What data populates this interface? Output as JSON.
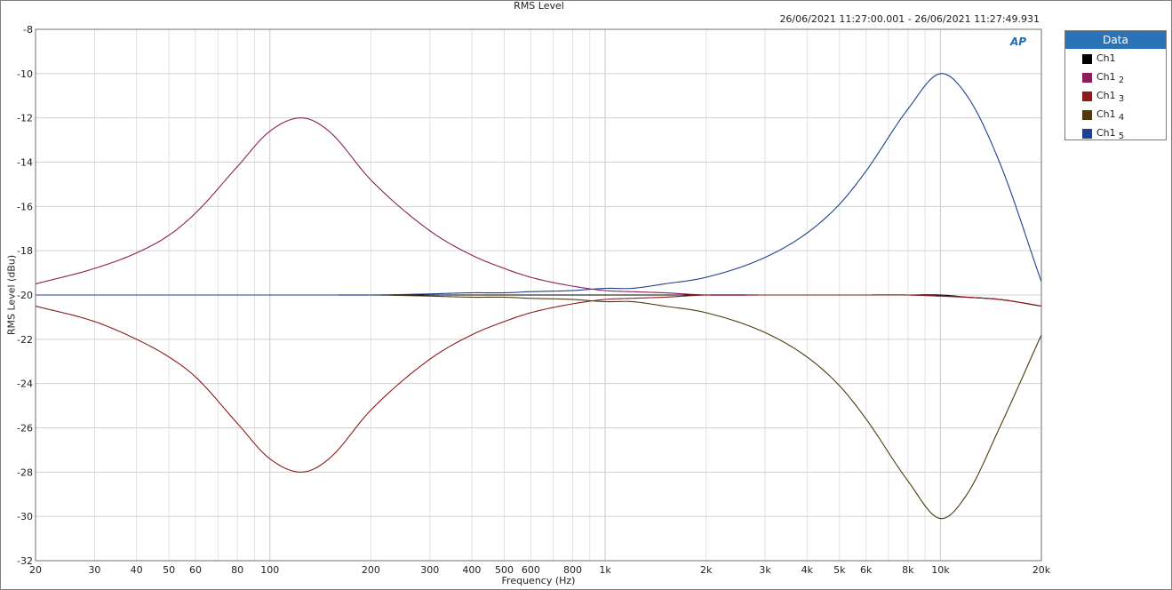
{
  "chart_data": {
    "type": "line",
    "title": "RMS Level",
    "subtitle": "26/06/2021 11:27:00.001 - 26/06/2021 11:27:49.931",
    "xlabel": "Frequency (Hz)",
    "ylabel": "RMS Level (dBu)",
    "xscale": "log",
    "xlim": [
      20,
      20000
    ],
    "ylim": [
      -32,
      -8
    ],
    "grid": true,
    "legend_position": "right",
    "legend_title": "Data",
    "x_ticks": [
      20,
      30,
      40,
      50,
      60,
      80,
      100,
      200,
      300,
      400,
      500,
      600,
      800,
      1000,
      2000,
      3000,
      4000,
      5000,
      6000,
      8000,
      10000,
      20000
    ],
    "x_tick_labels": [
      "20",
      "30",
      "40",
      "50",
      "60",
      "80",
      "100",
      "200",
      "300",
      "400",
      "500",
      "600",
      "800",
      "1k",
      "2k",
      "3k",
      "4k",
      "5k",
      "6k",
      "8k",
      "10k",
      "20k"
    ],
    "y_ticks": [
      -8,
      -10,
      -12,
      -14,
      -16,
      -18,
      -20,
      -22,
      -24,
      -26,
      -28,
      -30,
      -32
    ],
    "y_tick_labels": [
      "-8",
      "-10",
      "-12",
      "-14",
      "-16",
      "-18",
      "-20",
      "-22",
      "-24",
      "-26",
      "-28",
      "-30",
      "-32"
    ],
    "x": [
      20,
      30,
      40,
      50,
      60,
      80,
      100,
      125,
      150,
      200,
      300,
      400,
      500,
      600,
      800,
      1000,
      1200,
      1500,
      2000,
      3000,
      4000,
      5000,
      6000,
      8000,
      10000,
      12000,
      15000,
      20000
    ],
    "series": [
      {
        "name": "Ch1",
        "subscript": "",
        "color": "#000000",
        "values": [
          -20.0,
          -20.0,
          -20.0,
          -20.0,
          -20.0,
          -20.0,
          -20.0,
          -20.0,
          -20.0,
          -20.0,
          -20.0,
          -20.0,
          -20.0,
          -20.0,
          -20.0,
          -20.0,
          -20.0,
          -20.0,
          -20.0,
          -20.0,
          -20.0,
          -20.0,
          -20.0,
          -20.0,
          -20.0,
          -20.1,
          -20.2,
          -20.5
        ]
      },
      {
        "name": "Ch1",
        "subscript": "2",
        "color": "#8b1e5a",
        "values": [
          -19.5,
          -18.8,
          -18.1,
          -17.3,
          -16.3,
          -14.2,
          -12.6,
          -12.0,
          -12.6,
          -14.8,
          -17.1,
          -18.2,
          -18.8,
          -19.2,
          -19.6,
          -19.8,
          -19.85,
          -19.9,
          -20.0,
          -20.0,
          -20.0,
          -20.0,
          -20.0,
          -20.0,
          -20.05,
          -20.1,
          -20.2,
          -20.5
        ]
      },
      {
        "name": "Ch1",
        "subscript": "3",
        "color": "#8b1c1c",
        "values": [
          -20.5,
          -21.2,
          -22.0,
          -22.8,
          -23.7,
          -25.8,
          -27.4,
          -28.0,
          -27.4,
          -25.2,
          -22.9,
          -21.8,
          -21.2,
          -20.8,
          -20.4,
          -20.2,
          -20.15,
          -20.1,
          -20.0,
          -20.0,
          -20.0,
          -20.0,
          -20.0,
          -20.0,
          -20.05,
          -20.1,
          -20.2,
          -20.5
        ]
      },
      {
        "name": "Ch1",
        "subscript": "4",
        "color": "#4d3a10",
        "values": [
          -20.0,
          -20.0,
          -20.0,
          -20.0,
          -20.0,
          -20.0,
          -20.0,
          -20.0,
          -20.0,
          -20.0,
          -20.05,
          -20.1,
          -20.1,
          -20.15,
          -20.2,
          -20.3,
          -20.3,
          -20.5,
          -20.8,
          -21.7,
          -22.8,
          -24.1,
          -25.6,
          -28.4,
          -30.1,
          -29.0,
          -26.0,
          -21.8
        ]
      },
      {
        "name": "Ch1",
        "subscript": "5",
        "color": "#1f3f8f",
        "values": [
          -20.0,
          -20.0,
          -20.0,
          -20.0,
          -20.0,
          -20.0,
          -20.0,
          -20.0,
          -20.0,
          -20.0,
          -19.95,
          -19.9,
          -19.9,
          -19.85,
          -19.8,
          -19.7,
          -19.7,
          -19.5,
          -19.2,
          -18.3,
          -17.2,
          -15.9,
          -14.4,
          -11.6,
          -10.0,
          -11.0,
          -14.0,
          -19.4
        ]
      }
    ]
  }
}
